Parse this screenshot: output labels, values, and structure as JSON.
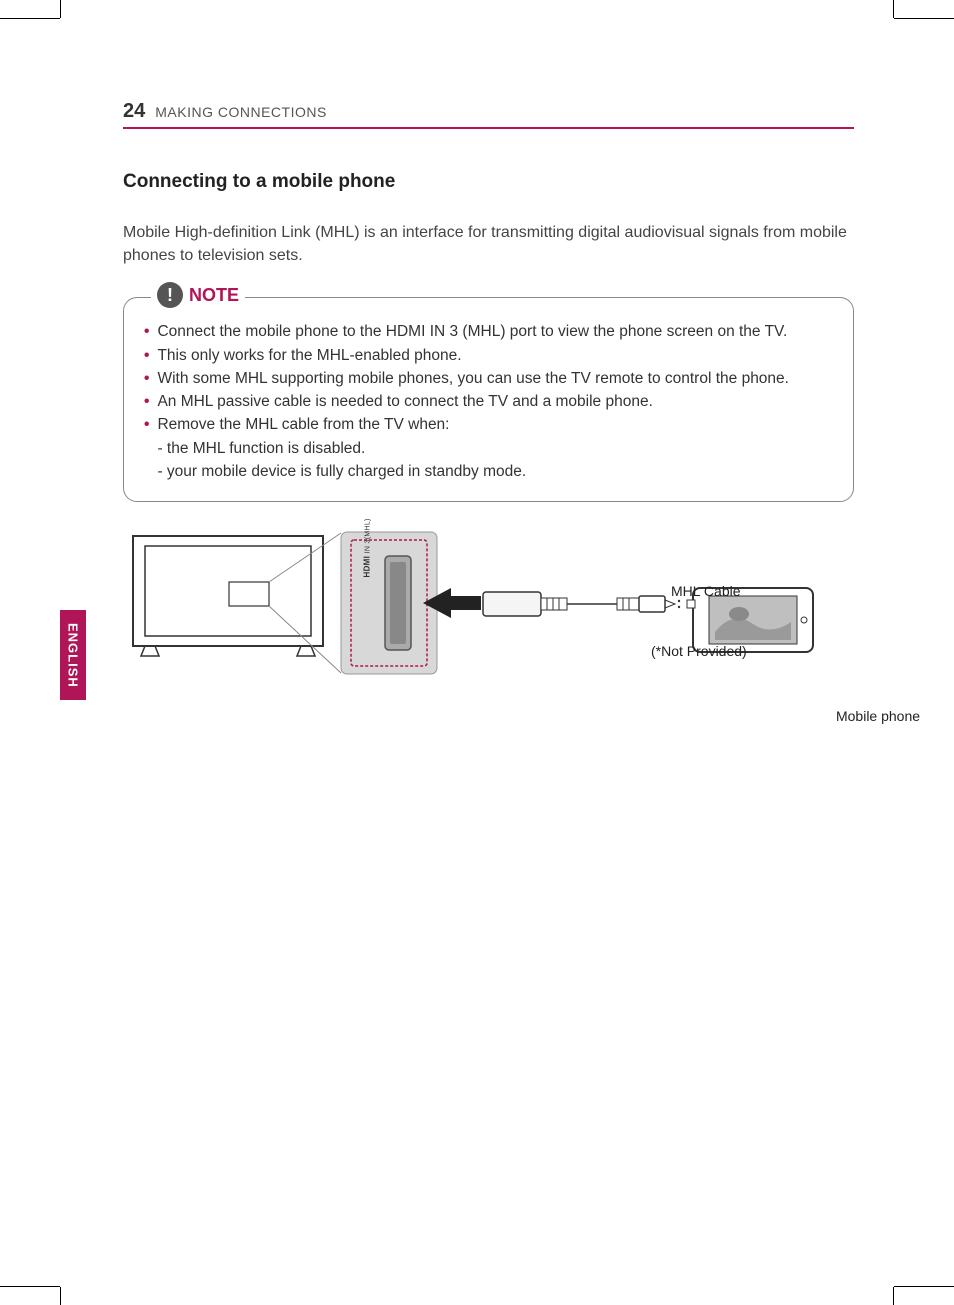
{
  "header": {
    "page_number": "24",
    "section": "MAKING CONNECTIONS"
  },
  "subheading": "Connecting to a mobile phone",
  "intro": "Mobile High-definition Link (MHL) is an interface for transmitting digital audiovisual signals from mobile phones to television sets.",
  "note": {
    "label": "NOTE",
    "items": [
      "Connect the mobile phone to the HDMI IN 3 (MHL) port to view the phone screen on the TV.",
      "This only works for the MHL-enabled phone.",
      "With some MHL supporting mobile phones, you can use the TV remote to control the phone.",
      "An MHL passive cable is needed to connect the TV and a mobile phone.",
      "Remove the MHL cable from the TV when:"
    ],
    "sublines": [
      "- the MHL function is disabled.",
      "- your mobile device is fully charged in standby mode."
    ]
  },
  "diagram": {
    "cable_label": "MHL Cable",
    "not_provided": "(*Not Provided)",
    "phone_label": "Mobile phone",
    "port_label_prefix": "HDMI",
    "port_label_suffix": "IN 3(MHL)"
  },
  "sidebar": {
    "language": "ENGLISH"
  }
}
